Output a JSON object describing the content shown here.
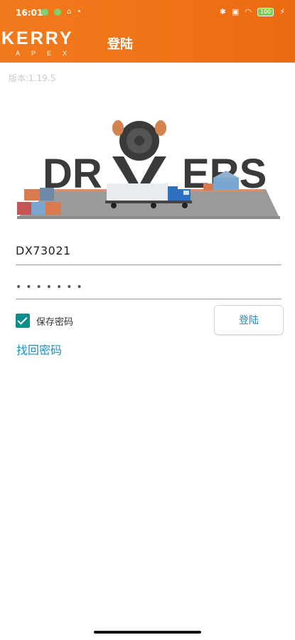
{
  "status_bar": {
    "time": "16:01",
    "battery": "100"
  },
  "header": {
    "logo_text": "KERRY",
    "logo_subtext": "APEX",
    "title": "登陆"
  },
  "version": "版本:1.19.5",
  "hero": {
    "text_left": "DR",
    "text_right": "ERS"
  },
  "form": {
    "username_value": "DX73021",
    "password_mask": "•••••••",
    "remember_label": "保存密码",
    "remember_checked": true,
    "login_label": "登陆",
    "forgot_label": "找回密码"
  },
  "colors": {
    "header": "#ef7316",
    "checkbox": "#0f8c8c",
    "link": "#1d8fcb"
  }
}
